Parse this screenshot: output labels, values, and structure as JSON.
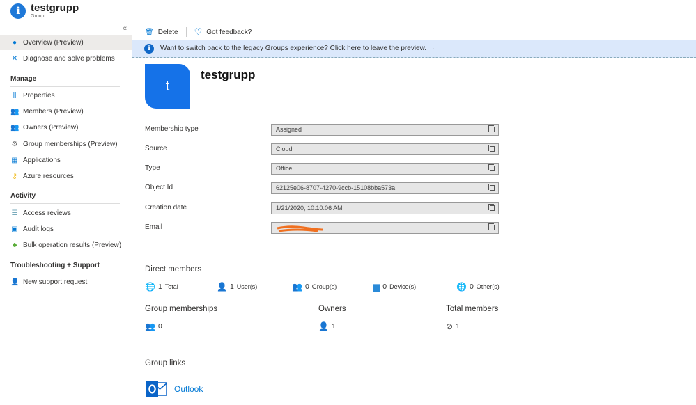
{
  "header": {
    "title": "testgrupp",
    "subtitle": "Group"
  },
  "sidebar": {
    "items": [
      {
        "label": "Overview (Preview)",
        "icon": "info-icon"
      },
      {
        "label": "Diagnose and solve problems",
        "icon": "wrench-icon"
      }
    ],
    "manage_label": "Manage",
    "manage": [
      {
        "label": "Properties"
      },
      {
        "label": "Members (Preview)"
      },
      {
        "label": "Owners (Preview)"
      },
      {
        "label": "Group memberships (Preview)"
      },
      {
        "label": "Applications"
      },
      {
        "label": "Azure resources"
      }
    ],
    "activity_label": "Activity",
    "activity": [
      {
        "label": "Access reviews"
      },
      {
        "label": "Audit logs"
      },
      {
        "label": "Bulk operation results (Preview)"
      }
    ],
    "support_label": "Troubleshooting + Support",
    "support": [
      {
        "label": "New support request"
      }
    ]
  },
  "toolbar": {
    "delete": "Delete",
    "feedback": "Got feedback?"
  },
  "banner": {
    "text": "Want to switch back to the legacy Groups experience? Click here to leave the preview. →"
  },
  "group": {
    "initial": "t",
    "name": "testgrupp"
  },
  "fields": [
    {
      "label": "Membership type",
      "value": "Assigned"
    },
    {
      "label": "Source",
      "value": "Cloud"
    },
    {
      "label": "Type",
      "value": "Office"
    },
    {
      "label": "Object Id",
      "value": "62125e06-8707-4270-9ccb-15108bba573a"
    },
    {
      "label": "Creation date",
      "value": "1/21/2020, 10:10:06 AM"
    },
    {
      "label": "Email",
      "value": ""
    }
  ],
  "direct": {
    "title": "Direct members",
    "total": {
      "n": "1",
      "label": "Total"
    },
    "users": {
      "n": "1",
      "label": "User(s)"
    },
    "groups": {
      "n": "0",
      "label": "Group(s)"
    },
    "devices": {
      "n": "0",
      "label": "Device(s)"
    },
    "others": {
      "n": "0",
      "label": "Other(s)"
    }
  },
  "summary": {
    "gm_label": "Group memberships",
    "gm": "0",
    "owners_label": "Owners",
    "owners": "1",
    "tm_label": "Total members",
    "tm": "1"
  },
  "links": {
    "title": "Group links",
    "outlook": "Outlook"
  }
}
